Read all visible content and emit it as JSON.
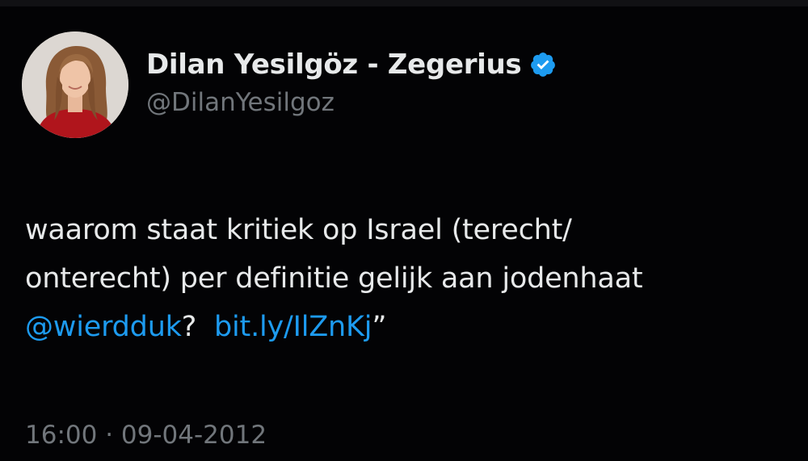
{
  "tweet": {
    "author": {
      "display_name": "Dilan Yesilgöz - Zegerius",
      "handle": "@DilanYesilgoz",
      "verified_icon": "verified-badge-icon",
      "avatar_icon": "profile-avatar"
    },
    "text": {
      "line1": "waarom staat kritiek op Israel (terecht/",
      "line2": "onterecht) per definitie gelijk aan jodenhaat",
      "mention": "@wierdduk",
      "question_mark": "?",
      "link": "bit.ly/IlZnKj",
      "closing_quote": "”"
    },
    "timestamp": {
      "time": "16:00",
      "separator": "·",
      "date": "09-04-2012"
    }
  },
  "colors": {
    "background": "#030305",
    "text": "#e7e9ea",
    "secondary_text": "#71767b",
    "link": "#1d9bf0"
  }
}
